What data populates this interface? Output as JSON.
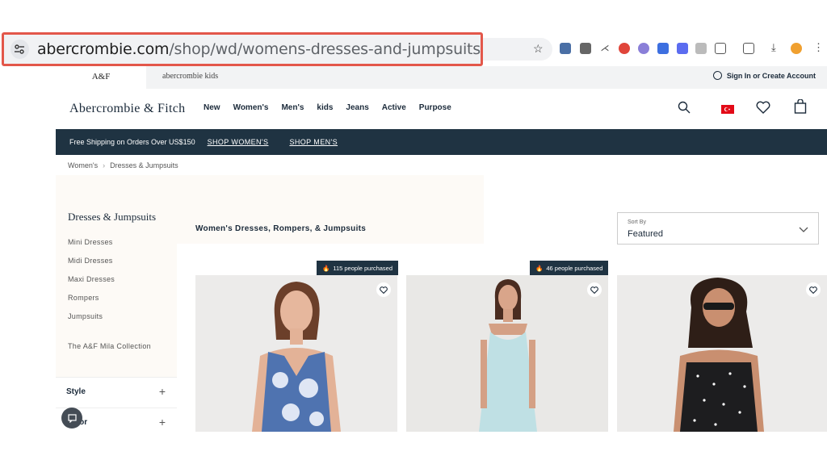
{
  "browser": {
    "url_domain": "abercrombie.com",
    "url_path": "/shop/wd/womens-dresses-and-jumpsuits"
  },
  "topbar": {
    "brand_tab": "A&F",
    "kids_tab": "abercrombie kids",
    "signin": "Sign In or Create Account"
  },
  "header": {
    "logo": "Abercrombie & Fitch",
    "nav": [
      "New",
      "Women's",
      "Men's",
      "kids",
      "Jeans",
      "Active",
      "Purpose"
    ]
  },
  "promo": {
    "text": "Free Shipping on Orders Over US$150",
    "shop_women": "SHOP WOMEN'S",
    "shop_men": "SHOP MEN'S"
  },
  "breadcrumb": {
    "items": [
      "Women's",
      "Dresses & Jumpsuits"
    ]
  },
  "sidebar": {
    "title": "Dresses & Jumpsuits",
    "items": [
      "Mini Dresses",
      "Midi Dresses",
      "Maxi Dresses",
      "Rompers",
      "Jumpsuits",
      "The A&F Mila Collection"
    ],
    "facets": [
      "Style",
      "Color"
    ]
  },
  "main": {
    "heading": "Women's Dresses, Rompers, & Jumpsuits",
    "sort_label": "Sort By",
    "sort_value": "Featured",
    "badges": [
      "115 people purchased",
      "46 people purchased"
    ]
  },
  "colors": {
    "navy": "#1f3342",
    "highlight": "#e3574a"
  }
}
